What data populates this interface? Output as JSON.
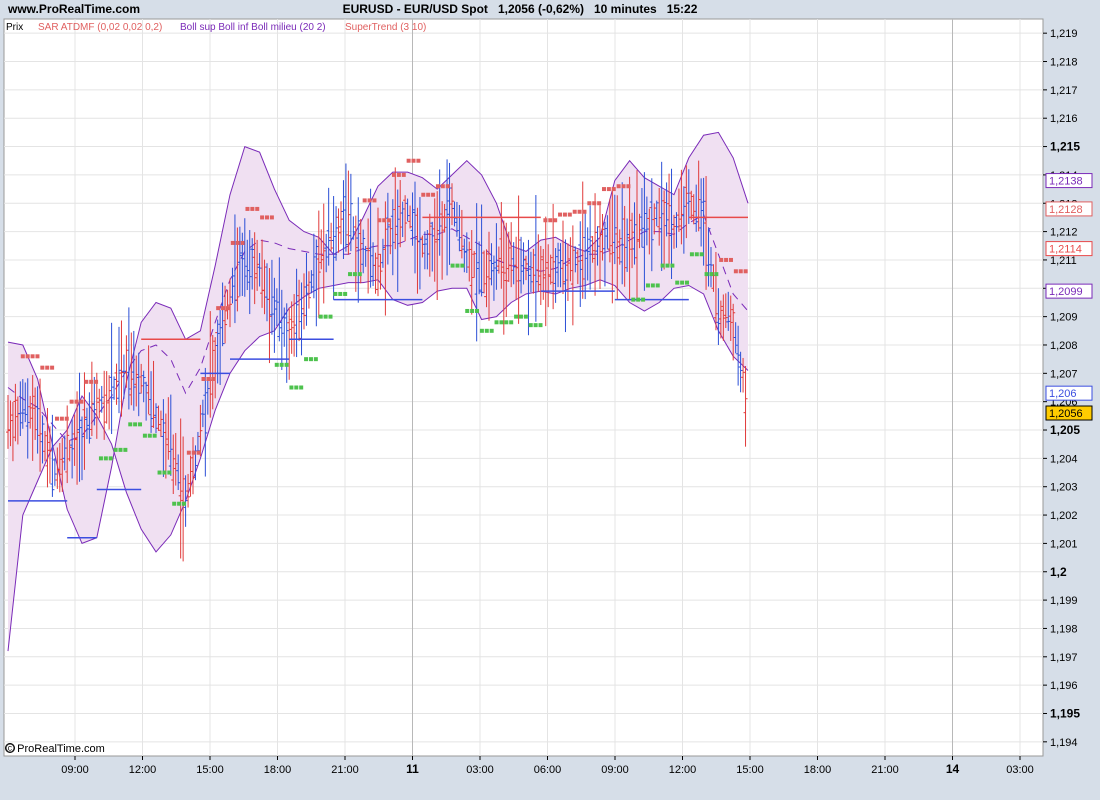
{
  "header": {
    "site": "www.ProRealTime.com",
    "instrument": "EURUSD - EUR/USD Spot",
    "price_change": "1,2056 (-0,62%)",
    "timeframe": "10 minutes",
    "time": "15:22"
  },
  "legend": {
    "panel": "Prix",
    "sar": "SAR ATDMF (0,02 0,02 0,2)",
    "boll": "Boll sup Boll inf Boll milieu (20 2)",
    "supertrend": "SuperTrend (3 10)"
  },
  "copyright": "© ProRealTime.com",
  "colors": {
    "up_bar": "#2b4fd6",
    "down_bar": "#e03a3a",
    "sar_red": "#e06060",
    "sar_green": "#4dc24d",
    "band_fill": "#f0e0f2",
    "band_line": "#7a2ab8",
    "supertrend_red": "#e84a4a",
    "supertrend_blue": "#3b4ee0",
    "last_price_bg": "#ffcc00"
  },
  "chart_data": {
    "type": "line",
    "title": "EURUSD - EUR/USD Spot",
    "ylim": [
      1.1935,
      1.2195
    ],
    "y_ticks": [
      "1,219",
      "1,218",
      "1,217",
      "1,216",
      "1,215",
      "1,214",
      "1,213",
      "1,212",
      "1,211",
      "1,21",
      "1,209",
      "1,208",
      "1,207",
      "1,206",
      "1,205",
      "1,204",
      "1,203",
      "1,202",
      "1,201",
      "1,2",
      "1,199",
      "1,198",
      "1,197",
      "1,196",
      "1,195",
      "1,194"
    ],
    "y_major": [
      "1,215",
      "1,205",
      "1,2",
      "1,195"
    ],
    "x_ticks": [
      {
        "label": "09:00",
        "major": false
      },
      {
        "label": "12:00",
        "major": false
      },
      {
        "label": "15:00",
        "major": false
      },
      {
        "label": "18:00",
        "major": false
      },
      {
        "label": "21:00",
        "major": false
      },
      {
        "label": "11",
        "major": true
      },
      {
        "label": "03:00",
        "major": false
      },
      {
        "label": "06:00",
        "major": false
      },
      {
        "label": "09:00",
        "major": false
      },
      {
        "label": "12:00",
        "major": false
      },
      {
        "label": "15:00",
        "major": false
      },
      {
        "label": "18:00",
        "major": false
      },
      {
        "label": "21:00",
        "major": false
      },
      {
        "label": "14",
        "major": true
      },
      {
        "label": "03:00",
        "major": false
      }
    ],
    "series": [
      {
        "name": "Boll sup",
        "values": [
          1.2081,
          1.208,
          1.2068,
          1.2045,
          1.2022,
          1.201,
          1.2012,
          1.2037,
          1.2067,
          1.2088,
          1.2095,
          1.2093,
          1.2082,
          1.2085,
          1.2108,
          1.2133,
          1.215,
          1.2148,
          1.2135,
          1.2124,
          1.212,
          1.2118,
          1.2112,
          1.2115,
          1.2125,
          1.2136,
          1.2141,
          1.2141,
          1.2139,
          1.2135,
          1.214,
          1.2145,
          1.214,
          1.213,
          1.2115,
          1.2113,
          1.2117,
          1.2118,
          1.2115,
          1.2113,
          1.2118,
          1.2138,
          1.2145,
          1.2139,
          1.2136,
          1.2133,
          1.2146,
          1.2154,
          1.2155,
          1.2146,
          1.213
        ]
      },
      {
        "name": "Boll milieu",
        "values": [
          1.2065,
          1.2061,
          1.2058,
          1.2052,
          1.2046,
          1.2048,
          1.2055,
          1.2062,
          1.2071,
          1.2078,
          1.208,
          1.2075,
          1.2063,
          1.2072,
          1.2088,
          1.2103,
          1.2113,
          1.2117,
          1.2116,
          1.2114,
          1.2113,
          1.2112,
          1.2112,
          1.2112,
          1.2114,
          1.2115,
          1.2115,
          1.2117,
          1.2119,
          1.2119,
          1.2121,
          1.2118,
          1.2115,
          1.211,
          1.2108,
          1.2107,
          1.2106,
          1.2107,
          1.211,
          1.2112,
          1.2112,
          1.2114,
          1.2117,
          1.212,
          1.212,
          1.2119,
          1.2123,
          1.2126,
          1.2112,
          1.2098,
          1.2092
        ]
      },
      {
        "name": "Boll inf",
        "values": [
          1.1972,
          1.202,
          1.2032,
          1.2044,
          1.205,
          1.2062,
          1.2055,
          1.2045,
          1.2028,
          1.2015,
          1.2007,
          1.2013,
          1.2025,
          1.204,
          1.2057,
          1.207,
          1.2078,
          1.2083,
          1.2085,
          1.2093,
          1.2097,
          1.21,
          1.2101,
          1.2102,
          1.2102,
          1.2103,
          1.2096,
          1.2094,
          1.2095,
          1.2099,
          1.21,
          1.21,
          1.2089,
          1.209,
          1.2095,
          1.2098,
          1.2099,
          1.2098,
          1.21,
          1.2101,
          1.2103,
          1.2101,
          1.2095,
          1.2092,
          1.2095,
          1.21,
          1.2101,
          1.2098,
          1.2085,
          1.2076,
          1.2071
        ]
      },
      {
        "name": "Close",
        "values": [
          1.205,
          1.2058,
          1.2054,
          1.2036,
          1.2042,
          1.2049,
          1.206,
          1.2063,
          1.2072,
          1.2068,
          1.2055,
          1.2044,
          1.2024,
          1.205,
          1.2075,
          1.2098,
          1.211,
          1.2107,
          1.2093,
          1.2085,
          1.2095,
          1.211,
          1.2118,
          1.2125,
          1.2113,
          1.2106,
          1.2122,
          1.2127,
          1.2115,
          1.2118,
          1.2128,
          1.2112,
          1.2105,
          1.2108,
          1.211,
          1.2107,
          1.2106,
          1.2108,
          1.2109,
          1.2112,
          1.2117,
          1.2118,
          1.2116,
          1.2121,
          1.2128,
          1.2122,
          1.2132,
          1.2125,
          1.2092,
          1.2088,
          1.206
        ]
      }
    ]
  },
  "price_flags": [
    {
      "label": "1,2138",
      "value": 1.2138,
      "fg": "#7a2ab8",
      "bg": "#ffffff"
    },
    {
      "label": "1,2128",
      "value": 1.2128,
      "fg": "#e06060",
      "bg": "#ffffff"
    },
    {
      "label": "1,2114",
      "value": 1.2114,
      "fg": "#e84a4a",
      "bg": "#ffffff"
    },
    {
      "label": "1,2099",
      "value": 1.2099,
      "fg": "#7a2ab8",
      "bg": "#ffffff"
    },
    {
      "label": "1,206",
      "value": 1.2063,
      "fg": "#3b4ee0",
      "bg": "#ffffff"
    },
    {
      "label": "1,2056",
      "value": 1.2056,
      "fg": "#000000",
      "bg": "#ffcc00"
    }
  ]
}
